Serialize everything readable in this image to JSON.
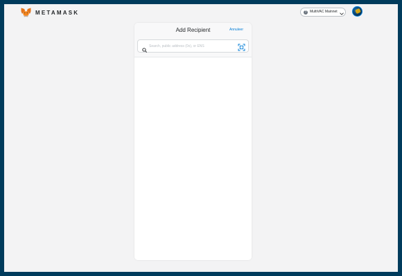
{
  "header": {
    "brand": "METAMASK",
    "logo_icon": "metamask-fox-icon",
    "network": {
      "label": "MultiVAC Mainnet",
      "icon": "network-status-icon",
      "chevron": "chevron-down-icon"
    },
    "account_avatar": "account-identicon"
  },
  "send": {
    "title": "Add Recipient",
    "cancel_label": "Annuleer",
    "search": {
      "placeholder": "Search, public address (0x), or ENS",
      "value": "",
      "icon": "search-icon",
      "scan_icon": "qr-scan-icon"
    }
  },
  "colors": {
    "frame": "#003b5c",
    "background": "#f3f3f4",
    "accent": "#037dd6",
    "text": "#24272a"
  }
}
